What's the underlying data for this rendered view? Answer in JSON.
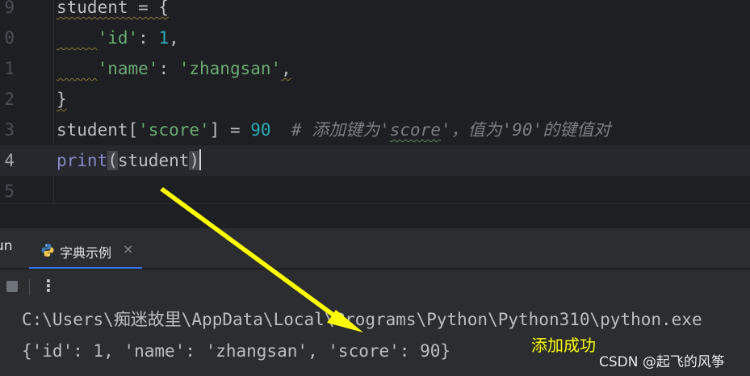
{
  "editor": {
    "lines": [
      {
        "number": "9",
        "tokens": [
          {
            "t": "student = {",
            "c": "tk-plain squiggle"
          }
        ]
      },
      {
        "number": "0",
        "tokens": [
          {
            "t": "    ",
            "c": "tk-plain squiggle"
          },
          {
            "t": "'id'",
            "c": "tk-str"
          },
          {
            "t": ": ",
            "c": "tk-plain"
          },
          {
            "t": "1",
            "c": "tk-num"
          },
          {
            "t": ",",
            "c": "tk-plain"
          }
        ]
      },
      {
        "number": "1",
        "tokens": [
          {
            "t": "    ",
            "c": "tk-plain squiggle"
          },
          {
            "t": "'name'",
            "c": "tk-str"
          },
          {
            "t": ": ",
            "c": "tk-plain"
          },
          {
            "t": "'zhangsan'",
            "c": "tk-str"
          },
          {
            "t": ",",
            "c": "tk-plain squiggle"
          }
        ]
      },
      {
        "number": "2",
        "tokens": [
          {
            "t": "}",
            "c": "tk-plain squiggle"
          }
        ]
      },
      {
        "number": "3",
        "tokens": [
          {
            "t": "student[",
            "c": "tk-plain"
          },
          {
            "t": "'score'",
            "c": "tk-str"
          },
          {
            "t": "] = ",
            "c": "tk-plain"
          },
          {
            "t": "90",
            "c": "tk-num"
          },
          {
            "t": "  # 添加键为'",
            "c": "tk-comment"
          },
          {
            "t": "score",
            "c": "tk-comment squiggle-green"
          },
          {
            "t": "'，值为'90'的键值对",
            "c": "tk-comment"
          }
        ]
      },
      {
        "number": "4",
        "current": true,
        "tokens": [
          {
            "t": "print",
            "c": "tk-builtin"
          },
          {
            "t": "(",
            "c": "tk-paren-hl"
          },
          {
            "t": "student",
            "c": "tk-plain"
          },
          {
            "t": ")",
            "c": "tk-paren-hl"
          }
        ]
      },
      {
        "number": "5",
        "tokens": []
      }
    ]
  },
  "run_panel": {
    "label": "un",
    "tab_label": "字典示例",
    "tab_close": "×",
    "more_label": "⋮"
  },
  "console": {
    "command": "C:\\Users\\痴迷故里\\AppData\\Local\\Programs\\Python\\Python310\\python.exe",
    "output": "{'id': 1, 'name': 'zhangsan', 'score': 90}"
  },
  "annotation": {
    "text": "添加成功",
    "color": "#ffff00"
  },
  "watermark": "CSDN @起飞的风筝",
  "colors": {
    "editor_bg": "#1e1f22",
    "panel_bg": "#2b2d30",
    "string": "#6aab73",
    "number": "#2aacb8",
    "builtin": "#8888c6",
    "comment": "#7a7e85",
    "accent": "#3574f0"
  }
}
